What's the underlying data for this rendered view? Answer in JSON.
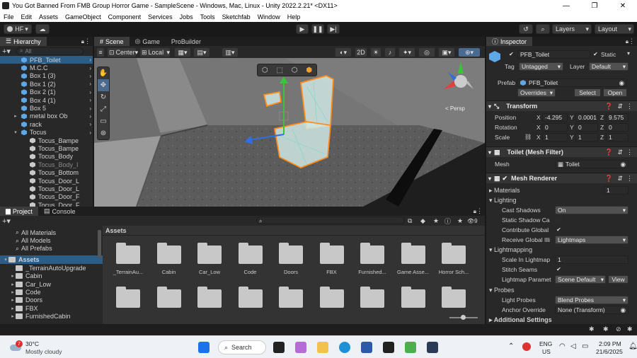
{
  "window": {
    "title": "You Got Banned From FMB Group Horror Game - SampleScene - Windows, Mac, Linux - Unity 2022.2.21* <DX11>",
    "minimize": "—",
    "maximize": "❐",
    "close": "✕"
  },
  "menu": [
    "File",
    "Edit",
    "Assets",
    "GameObject",
    "Component",
    "Services",
    "Jobs",
    "Tools",
    "Sketchfab",
    "Window",
    "Help"
  ],
  "toolbar": {
    "account": "HF",
    "layers": "Layers",
    "layout": "Layout"
  },
  "hierarchy": {
    "tab": "Hierarchy",
    "search_placeholder": "All",
    "items": [
      {
        "label": "PFB_Toilet",
        "indent": 1,
        "icon": "prefab"
      },
      {
        "label": "M.C.C",
        "indent": 1,
        "icon": "prefab"
      },
      {
        "label": "Box 1 (3)",
        "indent": 1,
        "icon": "prefab"
      },
      {
        "label": "Box 1 (2)",
        "indent": 1,
        "icon": "prefab"
      },
      {
        "label": "Box 2 (1)",
        "indent": 1,
        "icon": "prefab"
      },
      {
        "label": "Box 4 (1)",
        "indent": 1,
        "icon": "prefab"
      },
      {
        "label": "Box 5",
        "indent": 1,
        "icon": "prefab"
      },
      {
        "label": "metal box Ob",
        "indent": 1,
        "icon": "prefab",
        "expand": "▸"
      },
      {
        "label": "rack",
        "indent": 1,
        "icon": "prefab"
      },
      {
        "label": "Tocus",
        "indent": 1,
        "icon": "prefab",
        "expand": "▾"
      },
      {
        "label": "Tocus_Bampe",
        "indent": 2,
        "icon": "go"
      },
      {
        "label": "Tocus_Bampe",
        "indent": 2,
        "icon": "go"
      },
      {
        "label": "Tocus_Body",
        "indent": 2,
        "icon": "go"
      },
      {
        "label": "Tocus_Body_I",
        "indent": 2,
        "icon": "go",
        "dim": true
      },
      {
        "label": "Tocus_Bottom",
        "indent": 2,
        "icon": "go"
      },
      {
        "label": "Tocus_Door_L",
        "indent": 2,
        "icon": "go"
      },
      {
        "label": "Tocus_Door_L",
        "indent": 2,
        "icon": "go"
      },
      {
        "label": "Tocus_Door_F",
        "indent": 2,
        "icon": "go"
      },
      {
        "label": "Tocus_Door_F",
        "indent": 2,
        "icon": "go"
      }
    ]
  },
  "scene": {
    "tabs": [
      "Scene",
      "Game",
      "ProBuilder"
    ],
    "pivot": "Center",
    "space": "Local",
    "mode2d": "2D",
    "persp": "< Persp"
  },
  "project": {
    "tabs": [
      "Project",
      "Console"
    ],
    "favorites": [
      "All Materials",
      "All Models",
      "All Prefabs"
    ],
    "assets_root": "Assets",
    "tree": [
      "_TerrainAutoUpgrade",
      "Cabin",
      "Car_Low",
      "Code",
      "Doors",
      "FBX",
      "FurnishedCabin"
    ],
    "breadcrumb": "Assets",
    "hidden_count": "9",
    "grid": [
      "_TerrainAu...",
      "Cabin",
      "Car_Low",
      "Code",
      "Doors",
      "FBX",
      "Furnished...",
      "Game Asse...",
      "Horror Sch..."
    ]
  },
  "inspector": {
    "tab": "Inspector",
    "object_name": "PFB_Toilet",
    "static_label": "Static",
    "tag_label": "Tag",
    "tag_value": "Untagged",
    "layer_label": "Layer",
    "layer_value": "Default",
    "prefab_label": "Prefab",
    "prefab_value": "PFB_Toilet",
    "overrides": "Overrides",
    "select": "Select",
    "open": "Open",
    "transform": {
      "title": "Transform",
      "position_label": "Position",
      "rotation_label": "Rotation",
      "scale_label": "Scale",
      "position": {
        "x": "-4.295",
        "y": "0.0001",
        "z": "9.575"
      },
      "rotation": {
        "x": "0",
        "y": "0",
        "z": "0"
      },
      "scale": {
        "x": "1",
        "y": "1",
        "z": "1"
      }
    },
    "mesh_filter": {
      "title": "Toilet (Mesh Filter)",
      "mesh_label": "Mesh",
      "mesh_value": "Toilet"
    },
    "mesh_renderer": {
      "title": "Mesh Renderer",
      "materials_label": "Materials",
      "materials_count": "1",
      "lighting": "Lighting",
      "cast_shadows_label": "Cast Shadows",
      "cast_shadows_value": "On",
      "static_shadow_label": "Static Shadow Ca",
      "contribute_gi_label": "Contribute Global",
      "receive_gi_label": "Receive Global Illi",
      "receive_gi_value": "Lightmaps",
      "lightmapping": "Lightmapping",
      "scale_lightmap_label": "Scale In Lightmap",
      "scale_lightmap_value": "1",
      "stitch_seams_label": "Stitch Seams",
      "lightmap_param_label": "Lightmap Paramet",
      "lightmap_param_value": "Scene Default",
      "view": "View",
      "probes": "Probes",
      "light_probes_label": "Light Probes",
      "light_probes_value": "Blend Probes",
      "anchor_override_label": "Anchor Override",
      "anchor_override_value": "None (Transform)",
      "additional": "Additional Settings"
    }
  },
  "taskbar": {
    "weather_temp": "30°C",
    "weather_desc": "Mostly cloudy",
    "weather_badge": "7",
    "search": "Search",
    "lang1": "ENG",
    "lang2": "US",
    "time": "2:09 PM",
    "date": "21/6/2025"
  }
}
